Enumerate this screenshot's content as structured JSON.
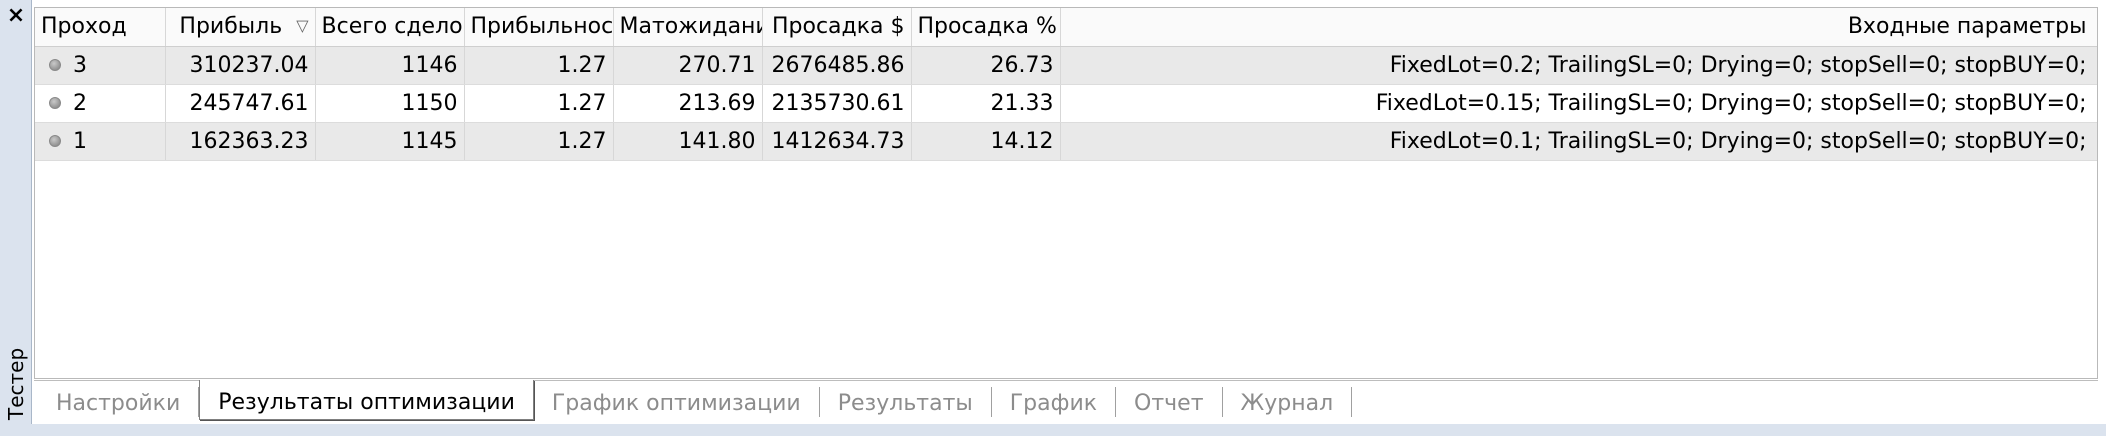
{
  "panel": {
    "close_glyph": "×",
    "title": "Тестер"
  },
  "table": {
    "headers": [
      "Проход",
      "Прибыль",
      "Всего сделок",
      "Прибыльность",
      "Матожидание...",
      "Просадка $",
      "Просадка %",
      "Входные параметры"
    ],
    "sort_glyph": "▽",
    "rows": [
      [
        "3",
        "310237.04",
        "1146",
        "1.27",
        "270.71",
        "2676485.86",
        "26.73",
        "FixedLot=0.2; TrailingSL=0; Drying=0; stopSell=0; stopBUY=0;"
      ],
      [
        "2",
        "245747.61",
        "1150",
        "1.27",
        "213.69",
        "2135730.61",
        "21.33",
        "FixedLot=0.15; TrailingSL=0; Drying=0; stopSell=0; stopBUY=0;"
      ],
      [
        "1",
        "162363.23",
        "1145",
        "1.27",
        "141.80",
        "1412634.73",
        "14.12",
        "FixedLot=0.1; TrailingSL=0; Drying=0; stopSell=0; stopBUY=0;"
      ]
    ]
  },
  "tabs": [
    {
      "label": "Настройки",
      "active": false
    },
    {
      "label": "Результаты оптимизации",
      "active": true
    },
    {
      "label": "График оптимизации",
      "active": false
    },
    {
      "label": "Результаты",
      "active": false
    },
    {
      "label": "График",
      "active": false
    },
    {
      "label": "Отчет",
      "active": false
    },
    {
      "label": "Журнал",
      "active": false
    }
  ]
}
